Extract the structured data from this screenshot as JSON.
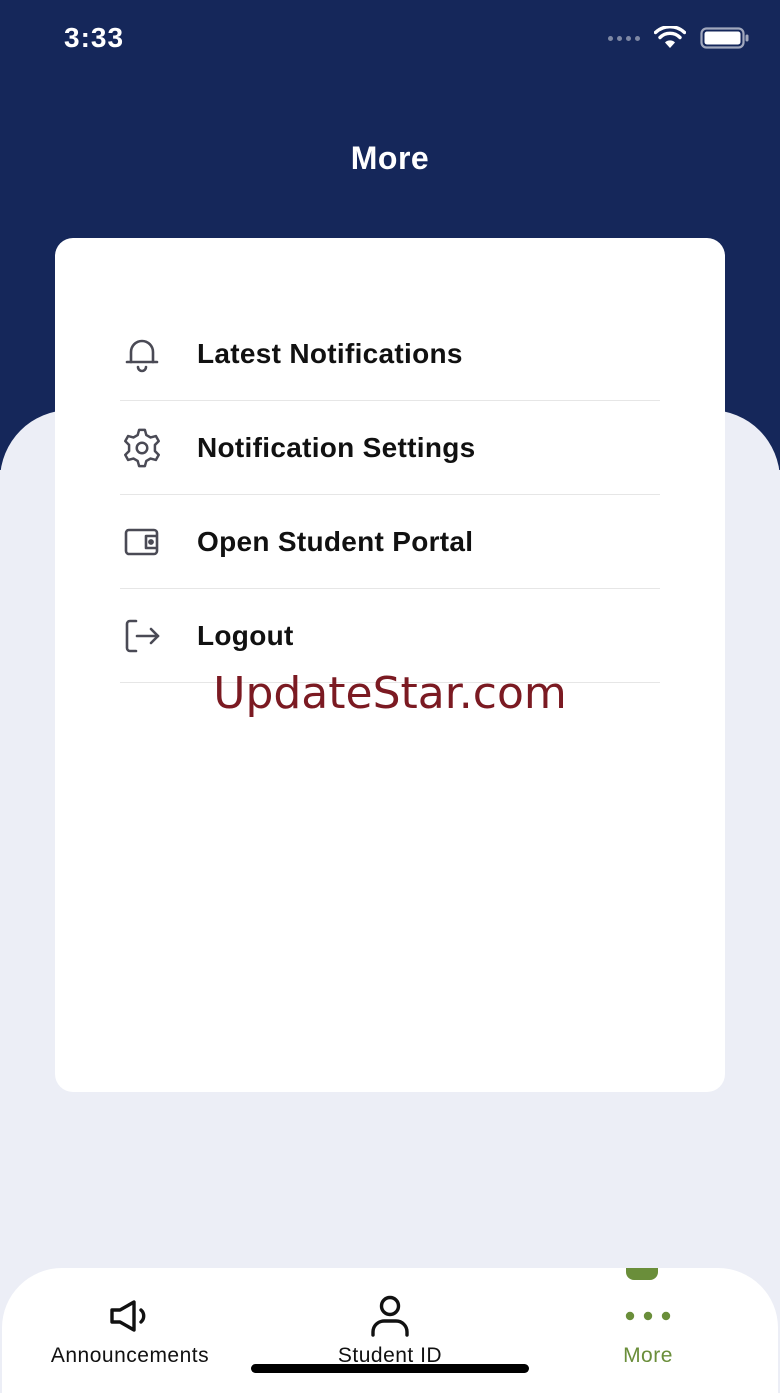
{
  "status_bar": {
    "time": "3:33"
  },
  "header": {
    "title": "More"
  },
  "menu": {
    "items": [
      {
        "label": "Latest Notifications",
        "icon": "bell-icon"
      },
      {
        "label": "Notification Settings",
        "icon": "gear-icon"
      },
      {
        "label": "Open Student Portal",
        "icon": "wallet-icon"
      },
      {
        "label": "Logout",
        "icon": "logout-icon"
      }
    ]
  },
  "watermark": {
    "text": "UpdateStar.com"
  },
  "tab_bar": {
    "tabs": [
      {
        "label": "Announcements",
        "icon": "megaphone-icon",
        "active": false
      },
      {
        "label": "Student ID",
        "icon": "person-icon",
        "active": false
      },
      {
        "label": "More",
        "icon": "more-dots-icon",
        "active": true
      }
    ]
  },
  "colors": {
    "header_bg": "#15275a",
    "page_bg": "#eceef6",
    "accent": "#6a8e3a",
    "watermark": "#7b1a22"
  }
}
